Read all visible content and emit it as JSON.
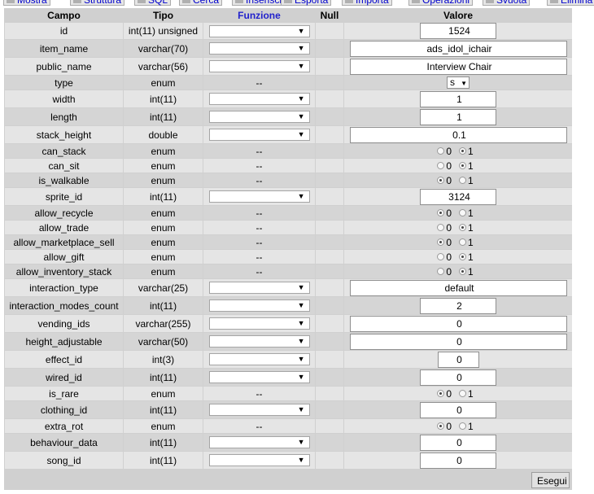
{
  "tabs": [
    {
      "label": "Mostra",
      "icon": "browse-icon"
    },
    {
      "label": "Struttura",
      "icon": "structure-icon"
    },
    {
      "label": "SQL",
      "icon": "sql-icon"
    },
    {
      "label": "Cerca",
      "icon": "search-icon"
    },
    {
      "label": "Inserisci",
      "icon": "insert-icon"
    },
    {
      "label": "Esporta",
      "icon": "export-icon"
    },
    {
      "label": "Importa",
      "icon": "import-icon"
    },
    {
      "label": "Operazioni",
      "icon": "operations-icon"
    },
    {
      "label": "Svuota",
      "icon": "empty-icon"
    },
    {
      "label": "Elimina",
      "icon": "drop-icon"
    }
  ],
  "headers": {
    "campo": "Campo",
    "tipo": "Tipo",
    "funzione": "Funzione",
    "null": "Null",
    "valore": "Valore"
  },
  "fields": [
    {
      "name": "id",
      "type": "int(11) unsigned",
      "kind": "text",
      "value": "1524",
      "width": "short",
      "func": true
    },
    {
      "name": "item_name",
      "type": "varchar(70)",
      "kind": "text",
      "value": "ads_idol_ichair",
      "width": "long",
      "func": true
    },
    {
      "name": "public_name",
      "type": "varchar(56)",
      "kind": "text",
      "value": "Interview Chair",
      "width": "long",
      "func": true
    },
    {
      "name": "type",
      "type": "enum",
      "kind": "select",
      "value": "s",
      "func": false,
      "func_text": "--"
    },
    {
      "name": "width",
      "type": "int(11)",
      "kind": "text",
      "value": "1",
      "width": "short",
      "func": true
    },
    {
      "name": "length",
      "type": "int(11)",
      "kind": "text",
      "value": "1",
      "width": "short",
      "func": true
    },
    {
      "name": "stack_height",
      "type": "double",
      "kind": "text",
      "value": "0.1",
      "width": "long",
      "func": true
    },
    {
      "name": "can_stack",
      "type": "enum",
      "kind": "radio",
      "options": [
        "0",
        "1"
      ],
      "selected": "1",
      "func": false,
      "func_text": "--"
    },
    {
      "name": "can_sit",
      "type": "enum",
      "kind": "radio",
      "options": [
        "0",
        "1"
      ],
      "selected": "1",
      "func": false,
      "func_text": "--"
    },
    {
      "name": "is_walkable",
      "type": "enum",
      "kind": "radio",
      "options": [
        "0",
        "1"
      ],
      "selected": "0",
      "func": false,
      "func_text": "--"
    },
    {
      "name": "sprite_id",
      "type": "int(11)",
      "kind": "text",
      "value": "3124",
      "width": "short",
      "func": true
    },
    {
      "name": "allow_recycle",
      "type": "enum",
      "kind": "radio",
      "options": [
        "0",
        "1"
      ],
      "selected": "0",
      "func": false,
      "func_text": "--"
    },
    {
      "name": "allow_trade",
      "type": "enum",
      "kind": "radio",
      "options": [
        "0",
        "1"
      ],
      "selected": "1",
      "func": false,
      "func_text": "--"
    },
    {
      "name": "allow_marketplace_sell",
      "type": "enum",
      "kind": "radio",
      "options": [
        "0",
        "1"
      ],
      "selected": "0",
      "func": false,
      "func_text": "--"
    },
    {
      "name": "allow_gift",
      "type": "enum",
      "kind": "radio",
      "options": [
        "0",
        "1"
      ],
      "selected": "1",
      "func": false,
      "func_text": "--"
    },
    {
      "name": "allow_inventory_stack",
      "type": "enum",
      "kind": "radio",
      "options": [
        "0",
        "1"
      ],
      "selected": "1",
      "func": false,
      "func_text": "--"
    },
    {
      "name": "interaction_type",
      "type": "varchar(25)",
      "kind": "text",
      "value": "default",
      "width": "long",
      "func": true
    },
    {
      "name": "interaction_modes_count",
      "type": "int(11)",
      "kind": "text",
      "value": "2",
      "width": "short",
      "func": true
    },
    {
      "name": "vending_ids",
      "type": "varchar(255)",
      "kind": "text",
      "value": "0",
      "width": "long",
      "func": true
    },
    {
      "name": "height_adjustable",
      "type": "varchar(50)",
      "kind": "text",
      "value": "0",
      "width": "long",
      "func": true
    },
    {
      "name": "effect_id",
      "type": "int(3)",
      "kind": "text",
      "value": "0",
      "width": "tiny",
      "func": true
    },
    {
      "name": "wired_id",
      "type": "int(11)",
      "kind": "text",
      "value": "0",
      "width": "short",
      "func": true
    },
    {
      "name": "is_rare",
      "type": "enum",
      "kind": "radio",
      "options": [
        "0",
        "1"
      ],
      "selected": "0",
      "func": false,
      "func_text": "--"
    },
    {
      "name": "clothing_id",
      "type": "int(11)",
      "kind": "text",
      "value": "0",
      "width": "short",
      "func": true
    },
    {
      "name": "extra_rot",
      "type": "enum",
      "kind": "radio",
      "options": [
        "0",
        "1"
      ],
      "selected": "0",
      "func": false,
      "func_text": "--"
    },
    {
      "name": "behaviour_data",
      "type": "int(11)",
      "kind": "text",
      "value": "0",
      "width": "short",
      "func": true
    },
    {
      "name": "song_id",
      "type": "int(11)",
      "kind": "text",
      "value": "0",
      "width": "short",
      "func": true
    }
  ],
  "submit_label": "Esegui"
}
